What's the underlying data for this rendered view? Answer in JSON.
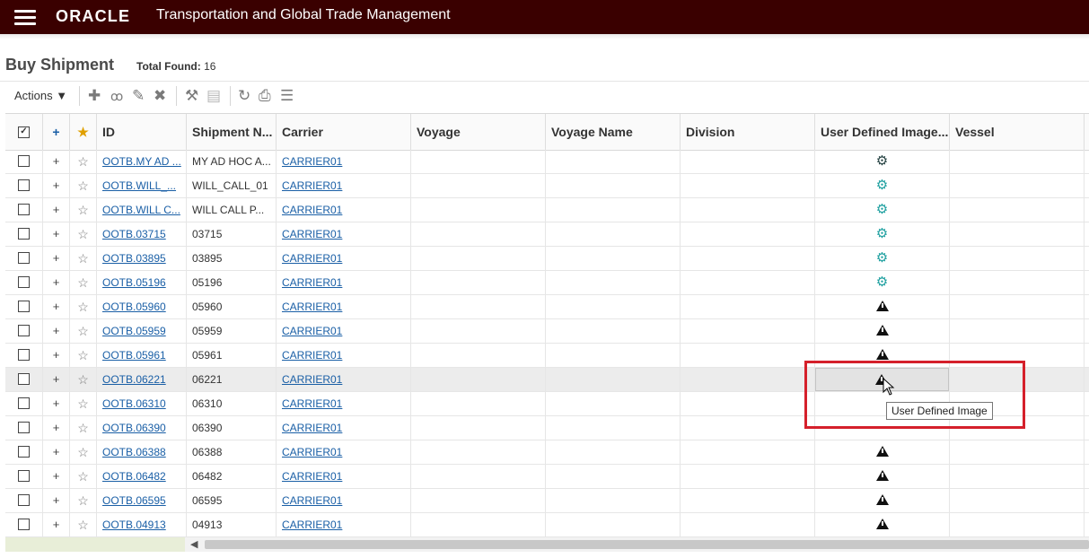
{
  "app": {
    "logo": "ORACLE",
    "title": "Transportation and Global Trade Management"
  },
  "page": {
    "title": "Buy Shipment",
    "total_found_label": "Total Found:",
    "total_found_value": "16"
  },
  "toolbar": {
    "actions_label": "Actions ▼",
    "icons": [
      "add-icon",
      "view-icon",
      "edit-icon",
      "delete-icon",
      "tools-icon",
      "save-icon",
      "refresh-icon",
      "print-icon",
      "columns-icon"
    ]
  },
  "columns": [
    "ID",
    "Shipment N...",
    "Carrier",
    "Voyage",
    "Voyage Name",
    "Division",
    "User Defined Image...",
    "Vessel"
  ],
  "rows": [
    {
      "id": "OOTB.MY AD ...",
      "shipment": "MY AD HOC A...",
      "carrier": "CARRIER01",
      "image": "gear-dark"
    },
    {
      "id": "OOTB.WILL_...",
      "shipment": "WILL_CALL_01",
      "carrier": "CARRIER01",
      "image": "gear"
    },
    {
      "id": "OOTB.WILL C...",
      "shipment": "WILL CALL P...",
      "carrier": "CARRIER01",
      "image": "gear"
    },
    {
      "id": "OOTB.03715",
      "shipment": "03715",
      "carrier": "CARRIER01",
      "image": "gear"
    },
    {
      "id": "OOTB.03895",
      "shipment": "03895",
      "carrier": "CARRIER01",
      "image": "gear"
    },
    {
      "id": "OOTB.05196",
      "shipment": "05196",
      "carrier": "CARRIER01",
      "image": "gear"
    },
    {
      "id": "OOTB.05960",
      "shipment": "05960",
      "carrier": "CARRIER01",
      "image": "warning"
    },
    {
      "id": "OOTB.05959",
      "shipment": "05959",
      "carrier": "CARRIER01",
      "image": "warning"
    },
    {
      "id": "OOTB.05961",
      "shipment": "05961",
      "carrier": "CARRIER01",
      "image": "warning"
    },
    {
      "id": "OOTB.06221",
      "shipment": "06221",
      "carrier": "CARRIER01",
      "image": "warning"
    },
    {
      "id": "OOTB.06310",
      "shipment": "06310",
      "carrier": "CARRIER01",
      "image": ""
    },
    {
      "id": "OOTB.06390",
      "shipment": "06390",
      "carrier": "CARRIER01",
      "image": ""
    },
    {
      "id": "OOTB.06388",
      "shipment": "06388",
      "carrier": "CARRIER01",
      "image": "warning"
    },
    {
      "id": "OOTB.06482",
      "shipment": "06482",
      "carrier": "CARRIER01",
      "image": "warning"
    },
    {
      "id": "OOTB.06595",
      "shipment": "06595",
      "carrier": "CARRIER01",
      "image": "warning"
    },
    {
      "id": "OOTB.04913",
      "shipment": "04913",
      "carrier": "CARRIER01",
      "image": "warning"
    }
  ],
  "highlighted_row_index": 9,
  "tooltip": "User Defined Image",
  "colors": {
    "topbar": "#3a0000",
    "link": "#1a5fa6",
    "highlight_box": "#d5202b",
    "gear": "#1a9e9e"
  }
}
